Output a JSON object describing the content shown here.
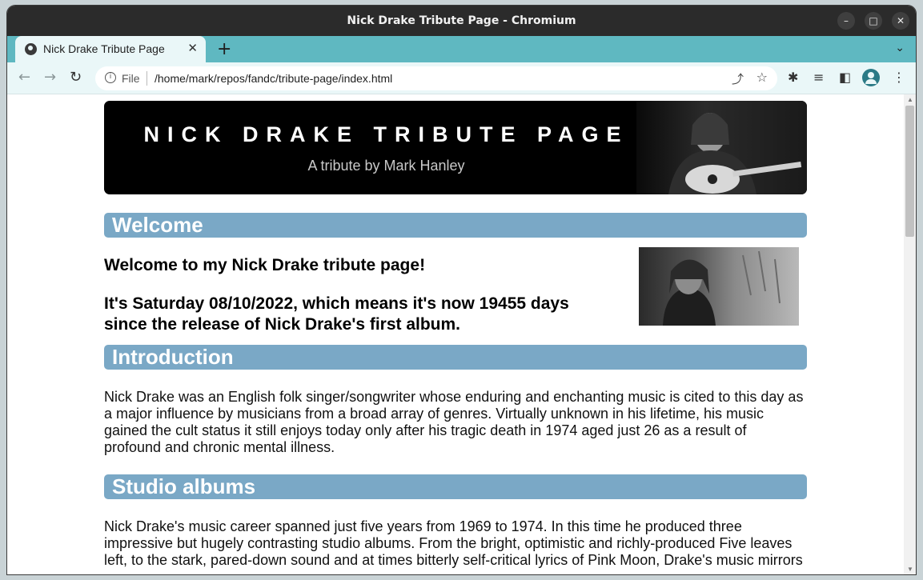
{
  "window": {
    "title": "Nick Drake Tribute Page - Chromium"
  },
  "tab": {
    "title": "Nick Drake Tribute Page"
  },
  "omnibox": {
    "scheme": "File",
    "url": "/home/mark/repos/fandc/tribute-page/index.html"
  },
  "header": {
    "title": "NICK DRAKE TRIBUTE PAGE",
    "subtitle": "A tribute by Mark Hanley"
  },
  "sections": {
    "welcome": {
      "heading": "Welcome",
      "line1": "Welcome to my Nick Drake tribute page!",
      "line2": "It's Saturday 08/10/2022, which means it's now 19455 days since the release of Nick Drake's first album."
    },
    "introduction": {
      "heading": "Introduction",
      "text": "Nick Drake was an English folk singer/songwriter whose enduring and enchanting music is cited to this day as a major influence by musicians from a broad array of genres. Virtually unknown in his lifetime, his music gained the cult status it still enjoys today only after his tragic death in 1974 aged just 26 as a result of profound and chronic mental illness."
    },
    "albums": {
      "heading": "Studio albums",
      "text": "Nick Drake's music career spanned just five years from 1969 to 1974. In this time he produced three impressive but hugely contrasting studio albums. From the bright, optimistic and richly-produced Five leaves left, to the stark, pared-down sound and at times bitterly self-critical lyrics of Pink Moon, Drake's music mirrors"
    }
  },
  "colors": {
    "section_header": "#7aa8c6",
    "tabstrip": "#5fb8c1",
    "titlebar": "#2b2b2b"
  }
}
